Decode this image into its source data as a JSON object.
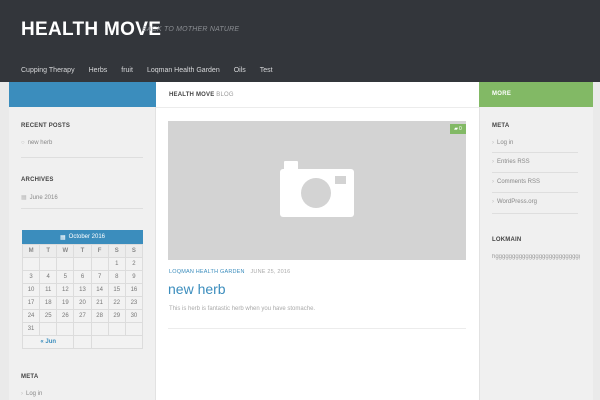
{
  "header": {
    "title": "HEALTH MOVE",
    "tagline": "BACK TO MOTHER NATURE",
    "nav": [
      "Cupping Therapy",
      "Herbs",
      "fruit",
      "Loqman Health Garden",
      "Oils",
      "Test"
    ]
  },
  "colors": {
    "header_bg": "#33363b",
    "accent_blue": "#3b8dbd",
    "accent_green": "#82b965"
  },
  "left_sidebar": {
    "recent_posts_title": "RECENT POSTS",
    "recent_posts": [
      "new herb"
    ],
    "archives_title": "ARCHIVES",
    "archives": [
      "June 2016"
    ],
    "calendar": {
      "caption": "October 2016",
      "weekdays": [
        "M",
        "T",
        "W",
        "T",
        "F",
        "S",
        "S"
      ],
      "weeks": [
        [
          "",
          "",
          "",
          "",
          "",
          "1",
          "2"
        ],
        [
          "3",
          "4",
          "5",
          "6",
          "7",
          "8",
          "9"
        ],
        [
          "10",
          "11",
          "12",
          "13",
          "14",
          "15",
          "16"
        ],
        [
          "17",
          "18",
          "19",
          "20",
          "21",
          "22",
          "23"
        ],
        [
          "24",
          "25",
          "26",
          "27",
          "28",
          "29",
          "30"
        ],
        [
          "31",
          "",
          "",
          "",
          "",
          "",
          ""
        ]
      ],
      "prev_link": "« Jun"
    },
    "meta_title": "META",
    "meta_items": [
      "Log in"
    ]
  },
  "main": {
    "breadcrumb_site": "HEALTH MOVE",
    "breadcrumb_section": "BLOG",
    "comment_count": "0",
    "post": {
      "category": "LOQMAN HEALTH GARDEN",
      "date": "JUNE 25, 2016",
      "title": "new herb",
      "excerpt": "This is herb is fantastic herb when you have stomache."
    }
  },
  "right_sidebar": {
    "more_label": "MORE",
    "meta_title": "META",
    "meta_items": [
      "Log in",
      "Entries RSS",
      "Comments RSS",
      "WordPress.org"
    ],
    "lokmain_title": "LOKMAIN",
    "lokmain_text": "hgggggggggggggggggggggggggggggg"
  }
}
